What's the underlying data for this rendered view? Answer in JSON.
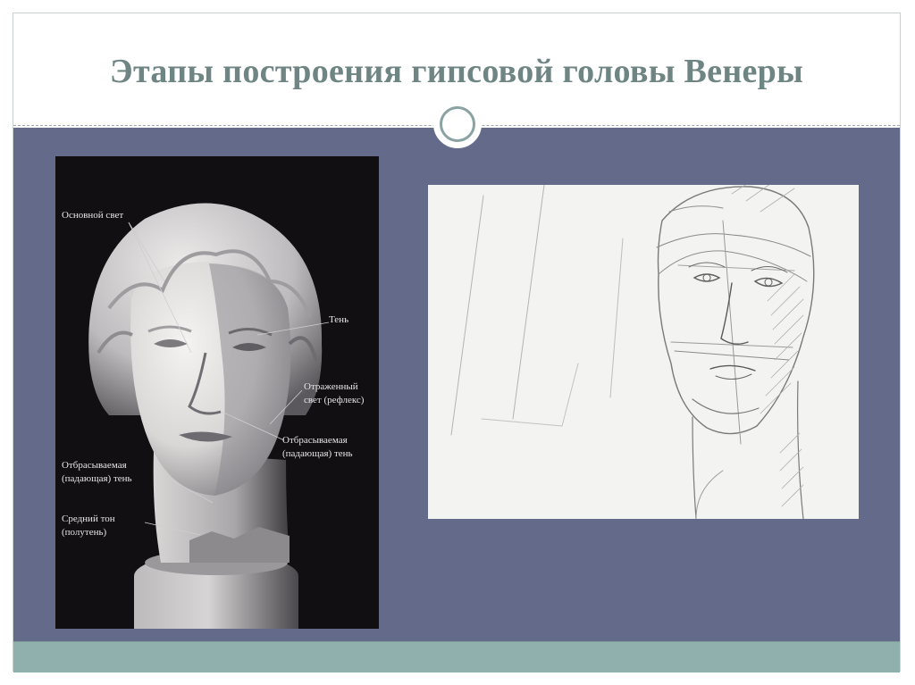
{
  "slide": {
    "title": "Этапы построения гипсовой головы Венеры"
  },
  "photo": {
    "labels": {
      "main_light": "Основной свет",
      "shadow": "Тень",
      "reflected_light": "Отраженный\nсвет (рефлекс)",
      "cast_shadow_right": "Отбрасываемая\n(падающая) тень",
      "cast_shadow_left": "Отбрасываемая\n(падающая) тень",
      "midtone": "Средний тон\n(полутень)"
    }
  },
  "colors": {
    "title": "#6f8583",
    "content_band": "#646a8a",
    "footer_band": "#8fb0ad",
    "ornament_ring": "#8aa3a2",
    "photo_background": "#120f13",
    "sketch_background": "#f3f3f2"
  }
}
